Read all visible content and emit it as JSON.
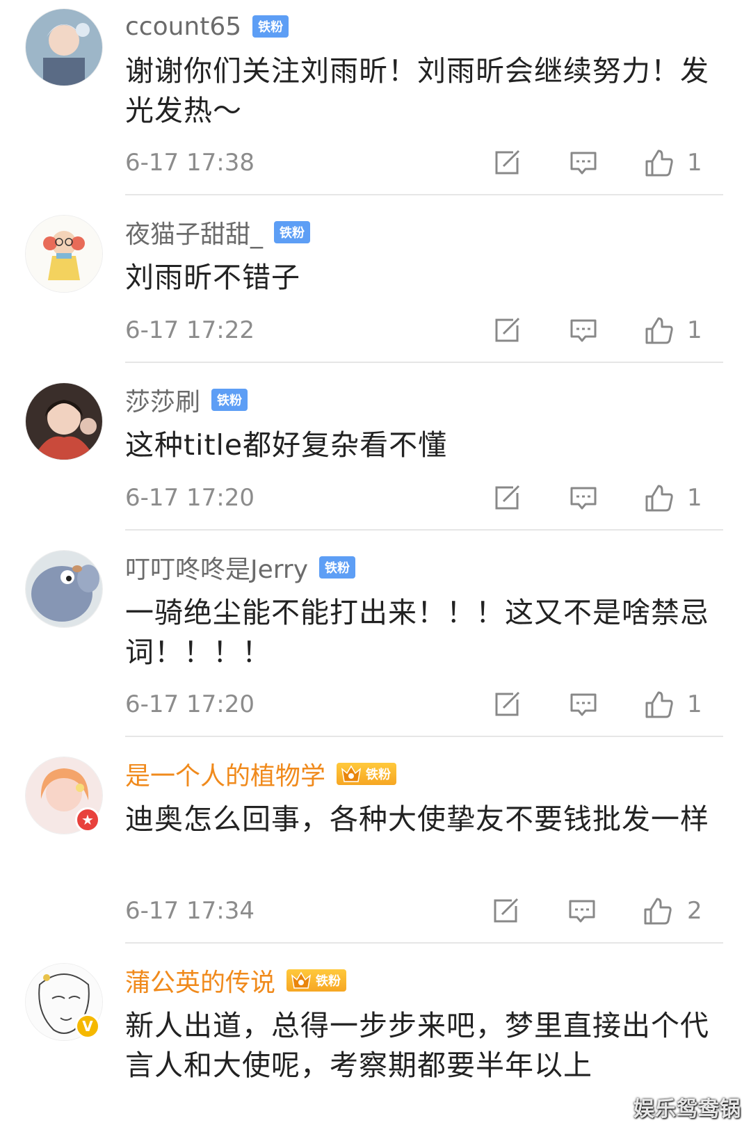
{
  "comments": [
    {
      "username": "ccount65",
      "badge": "铁粉",
      "text": "谢谢你们关注刘雨昕！刘雨昕会继续努力！发光发热～",
      "time": "6-17 17:38",
      "likes": "1"
    },
    {
      "username": "夜猫子甜甜_",
      "badge": "铁粉",
      "text": "刘雨昕不错子",
      "time": "6-17 17:22",
      "likes": "1"
    },
    {
      "username": "莎莎刷",
      "badge": "铁粉",
      "text": "这种title都好复杂看不懂",
      "time": "6-17 17:20",
      "likes": "1"
    },
    {
      "username": "叮叮咚咚是Jerry",
      "badge": "铁粉",
      "text": "一骑绝尘能不能打出来！！！这又不是啥禁忌词！！！！",
      "time": "6-17 17:20",
      "likes": "1"
    },
    {
      "username": "是一个人的植物学",
      "badge": "铁粉",
      "text": "迪奥怎么回事，各种大使挚友不要钱批发一样",
      "time": "6-17 17:34",
      "likes": "2"
    },
    {
      "username": "蒲公英的传说",
      "badge": "铁粉",
      "text": "新人出道，总得一步步来吧，梦里直接出个代言人和大使呢，考察期都要半年以上",
      "time": "",
      "likes": ""
    }
  ],
  "icons": {
    "repost": "repost-icon",
    "comment": "comment-icon",
    "like": "thumbs-up-icon",
    "crown": "crown-icon"
  },
  "colors": {
    "badge_blue": "#5d9ef5",
    "username_gold": "#f08a1c",
    "meta_gray": "#8c8c8c"
  },
  "watermark": "娱乐鸳鸯锅"
}
